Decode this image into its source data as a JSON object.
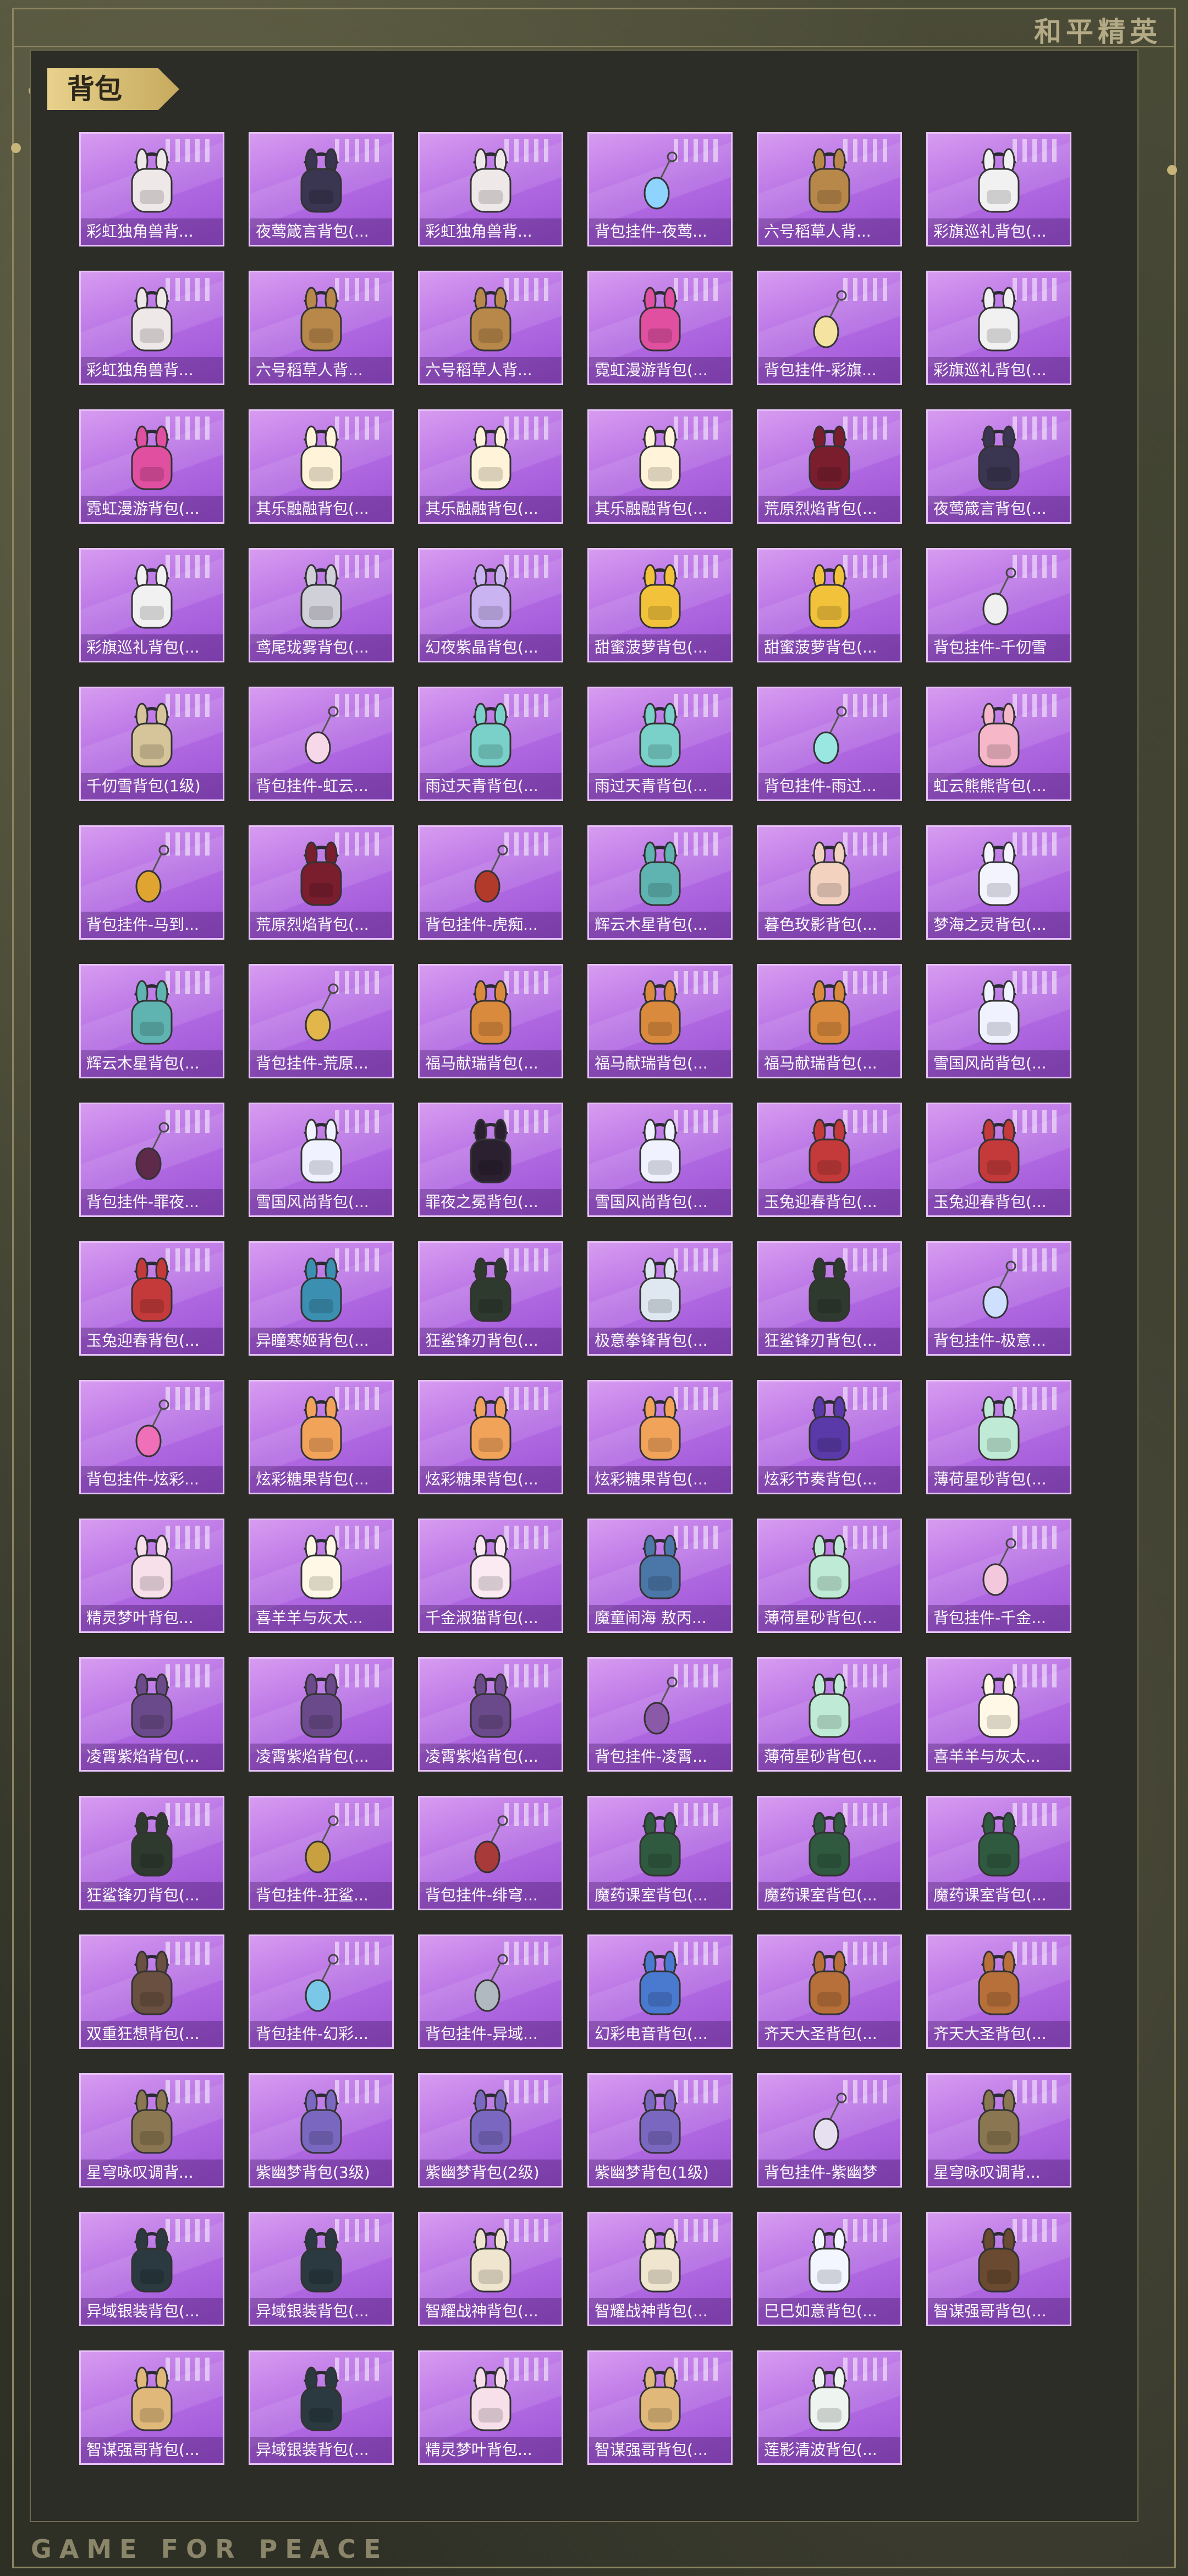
{
  "brand": "和平精英",
  "section_title": "背包",
  "footer": "GAME FOR PEACE",
  "items": [
    {
      "name": "彩虹独角兽背...",
      "icon": "bunny-backpack-icon",
      "color": "#efe8e8"
    },
    {
      "name": "夜莺箴言背包(...",
      "icon": "dark-pendant-backpack-icon",
      "color": "#3a3550"
    },
    {
      "name": "彩虹独角兽背...",
      "icon": "bunny-backpack-icon",
      "color": "#efe8e8"
    },
    {
      "name": "背包挂件-夜莺...",
      "icon": "pendant-charm-icon",
      "color": "#8fd3ff"
    },
    {
      "name": "六号稻草人背...",
      "icon": "scarecrow-backpack-icon",
      "color": "#b8874a"
    },
    {
      "name": "彩旗巡礼背包(...",
      "icon": "bunny-backpack-icon",
      "color": "#f1f1f1"
    },
    {
      "name": "彩虹独角兽背...",
      "icon": "bunny-backpack-icon",
      "color": "#efe8e8"
    },
    {
      "name": "六号稻草人背...",
      "icon": "scarecrow-backpack-icon",
      "color": "#b8874a"
    },
    {
      "name": "六号稻草人背...",
      "icon": "scarecrow-backpack-icon",
      "color": "#b8874a"
    },
    {
      "name": "霓虹漫游背包(...",
      "icon": "neon-backpack-icon",
      "color": "#e04fa0"
    },
    {
      "name": "背包挂件-彩旗...",
      "icon": "pendant-charm-icon",
      "color": "#f4e3a1"
    },
    {
      "name": "彩旗巡礼背包(...",
      "icon": "bunny-backpack-icon",
      "color": "#f1f1f1"
    },
    {
      "name": "霓虹漫游背包(...",
      "icon": "neon-backpack-icon",
      "color": "#e04fa0"
    },
    {
      "name": "其乐融融背包(...",
      "icon": "bunny-backpack-icon",
      "color": "#fff4d9"
    },
    {
      "name": "其乐融融背包(...",
      "icon": "bunny-backpack-icon",
      "color": "#fff4d9"
    },
    {
      "name": "其乐融融背包(...",
      "icon": "bunny-backpack-icon",
      "color": "#fff4d9"
    },
    {
      "name": "荒原烈焰背包(...",
      "icon": "dark-pendant-backpack-icon",
      "color": "#7a1e2e"
    },
    {
      "name": "夜莺箴言背包(...",
      "icon": "dark-pendant-backpack-icon",
      "color": "#3a3550"
    },
    {
      "name": "彩旗巡礼背包(...",
      "icon": "bunny-backpack-icon",
      "color": "#f1f1f1"
    },
    {
      "name": "鸢尾珑雾背包(...",
      "icon": "round-backpack-icon",
      "color": "#d0d0d8"
    },
    {
      "name": "幻夜紫晶背包(...",
      "icon": "round-backpack-icon",
      "color": "#c9b3f0"
    },
    {
      "name": "甜蜜菠萝背包(...",
      "icon": "pineapple-backpack-icon",
      "color": "#f2c23a"
    },
    {
      "name": "甜蜜菠萝背包(...",
      "icon": "pineapple-backpack-icon",
      "color": "#f2c23a"
    },
    {
      "name": "背包挂件-千仞雪",
      "icon": "feather-charm-icon",
      "color": "#f0f0f0"
    },
    {
      "name": "千仞雪背包(1级)",
      "icon": "round-backpack-icon",
      "color": "#d6c59a"
    },
    {
      "name": "背包挂件-虹云...",
      "icon": "pendant-charm-icon",
      "color": "#f7d8e8"
    },
    {
      "name": "雨过天青背包(...",
      "icon": "round-backpack-icon",
      "color": "#7ad1c9"
    },
    {
      "name": "雨过天青背包(...",
      "icon": "round-backpack-icon",
      "color": "#7ad1c9"
    },
    {
      "name": "背包挂件-雨过...",
      "icon": "pendant-charm-icon",
      "color": "#9ae6e1"
    },
    {
      "name": "虹云熊熊背包(...",
      "icon": "bear-backpack-icon",
      "color": "#f6b8c8"
    },
    {
      "name": "背包挂件-马到...",
      "icon": "horse-charm-icon",
      "color": "#e0a431"
    },
    {
      "name": "荒原烈焰背包(...",
      "icon": "dark-pendant-backpack-icon",
      "color": "#7a1e2e"
    },
    {
      "name": "背包挂件-虎痴...",
      "icon": "blade-charm-icon",
      "color": "#b23a2a"
    },
    {
      "name": "辉云木星背包(...",
      "icon": "round-backpack-icon",
      "color": "#5fb3b0"
    },
    {
      "name": "暮色玫影背包(...",
      "icon": "round-backpack-icon",
      "color": "#f3d2c0"
    },
    {
      "name": "梦海之灵背包(...",
      "icon": "bunny-backpack-icon",
      "color": "#f4f4ff"
    },
    {
      "name": "辉云木星背包(...",
      "icon": "round-backpack-icon",
      "color": "#5fb3b0"
    },
    {
      "name": "背包挂件-荒原...",
      "icon": "star-charm-icon",
      "color": "#e2b64a"
    },
    {
      "name": "福马献瑞背包(...",
      "icon": "horse-backpack-icon",
      "color": "#d98a3d"
    },
    {
      "name": "福马献瑞背包(...",
      "icon": "horse-backpack-icon",
      "color": "#d98a3d"
    },
    {
      "name": "福马献瑞背包(...",
      "icon": "horse-backpack-icon",
      "color": "#d98a3d"
    },
    {
      "name": "雪国风尚背包(...",
      "icon": "snowman-backpack-icon",
      "color": "#f0f3ff"
    },
    {
      "name": "背包挂件-罪夜...",
      "icon": "bat-charm-icon",
      "color": "#5d2a4a"
    },
    {
      "name": "雪国风尚背包(...",
      "icon": "snowman-backpack-icon",
      "color": "#f0f3ff"
    },
    {
      "name": "罪夜之冕背包(...",
      "icon": "dark-pendant-backpack-icon",
      "color": "#2a2030"
    },
    {
      "name": "雪国风尚背包(...",
      "icon": "snowman-backpack-icon",
      "color": "#f0f3ff"
    },
    {
      "name": "玉兔迎春背包(...",
      "icon": "rabbit-backpack-icon",
      "color": "#c43a3a"
    },
    {
      "name": "玉兔迎春背包(...",
      "icon": "rabbit-backpack-icon",
      "color": "#c43a3a"
    },
    {
      "name": "玉兔迎春背包(...",
      "icon": "rabbit-backpack-icon",
      "color": "#c43a3a"
    },
    {
      "name": "异瞳寒姬背包(...",
      "icon": "round-backpack-icon",
      "color": "#3b8fb0"
    },
    {
      "name": "狂鲨锋刃背包(...",
      "icon": "dark-pendant-backpack-icon",
      "color": "#2f3a2f"
    },
    {
      "name": "极意拳锋背包(...",
      "icon": "round-backpack-icon",
      "color": "#dfe8f0"
    },
    {
      "name": "狂鲨锋刃背包(...",
      "icon": "dark-pendant-backpack-icon",
      "color": "#2f3a2f"
    },
    {
      "name": "背包挂件-极意...",
      "icon": "pendant-charm-icon",
      "color": "#cfe0ff"
    },
    {
      "name": "背包挂件-炫彩...",
      "icon": "candy-charm-icon",
      "color": "#ef6fb8"
    },
    {
      "name": "炫彩糖果背包(...",
      "icon": "donut-backpack-icon",
      "color": "#f2a35a"
    },
    {
      "name": "炫彩糖果背包(...",
      "icon": "donut-backpack-icon",
      "color": "#f2a35a"
    },
    {
      "name": "炫彩糖果背包(...",
      "icon": "donut-backpack-icon",
      "color": "#f2a35a"
    },
    {
      "name": "炫彩节奏背包(...",
      "icon": "neon-backpack-icon",
      "color": "#5a3aa8"
    },
    {
      "name": "薄荷星砂背包(...",
      "icon": "round-backpack-icon",
      "color": "#bfead5"
    },
    {
      "name": "精灵梦叶背包...",
      "icon": "round-backpack-icon",
      "color": "#f7e0ea"
    },
    {
      "name": "喜羊羊与灰太...",
      "icon": "sheep-backpack-icon",
      "color": "#fff8e6"
    },
    {
      "name": "千金淑猫背包(...",
      "icon": "cat-backpack-icon",
      "color": "#fbeaf2"
    },
    {
      "name": "魔童闹海 敖丙...",
      "icon": "ring-backpack-icon",
      "color": "#4b77a8"
    },
    {
      "name": "薄荷星砂背包(...",
      "icon": "round-backpack-icon",
      "color": "#bfead5"
    },
    {
      "name": "背包挂件-千金...",
      "icon": "cat-charm-icon",
      "color": "#f3c8dc"
    },
    {
      "name": "凌霄紫焰背包(...",
      "icon": "round-backpack-icon",
      "color": "#6a4a8a"
    },
    {
      "name": "凌霄紫焰背包(...",
      "icon": "round-backpack-icon",
      "color": "#6a4a8a"
    },
    {
      "name": "凌霄紫焰背包(...",
      "icon": "round-backpack-icon",
      "color": "#6a4a8a"
    },
    {
      "name": "背包挂件-凌霄...",
      "icon": "pendant-charm-icon",
      "color": "#8a5aa8"
    },
    {
      "name": "薄荷星砂背包(...",
      "icon": "round-backpack-icon",
      "color": "#bfead5"
    },
    {
      "name": "喜羊羊与灰太...",
      "icon": "sheep-backpack-icon",
      "color": "#fff8e6"
    },
    {
      "name": "狂鲨锋刃背包(...",
      "icon": "dark-pendant-backpack-icon",
      "color": "#2f3a2f"
    },
    {
      "name": "背包挂件-狂鲨...",
      "icon": "blade-charm-icon",
      "color": "#c8a040"
    },
    {
      "name": "背包挂件-绯穹...",
      "icon": "blade-charm-icon",
      "color": "#a83a3a"
    },
    {
      "name": "魔药课室背包(...",
      "icon": "witch-backpack-icon",
      "color": "#2f5a40"
    },
    {
      "name": "魔药课室背包(...",
      "icon": "witch-backpack-icon",
      "color": "#2f5a40"
    },
    {
      "name": "魔药课室背包(...",
      "icon": "witch-backpack-icon",
      "color": "#2f5a40"
    },
    {
      "name": "双重狂想背包(...",
      "icon": "horse-backpack-icon",
      "color": "#6a5040"
    },
    {
      "name": "背包挂件-幻彩...",
      "icon": "cube-charm-icon",
      "color": "#7ac8e8"
    },
    {
      "name": "背包挂件-异域...",
      "icon": "blade-charm-icon",
      "color": "#b0b8c0"
    },
    {
      "name": "幻彩电音背包(...",
      "icon": "ring-backpack-icon",
      "color": "#4a7ad0"
    },
    {
      "name": "齐天大圣背包(...",
      "icon": "monkey-backpack-icon",
      "color": "#b8703a"
    },
    {
      "name": "齐天大圣背包(...",
      "icon": "monkey-backpack-icon",
      "color": "#b8703a"
    },
    {
      "name": "星穹咏叹调背...",
      "icon": "bunny-backpack-icon",
      "color": "#8a7650"
    },
    {
      "name": "紫幽梦背包(3级)",
      "icon": "round-backpack-icon",
      "color": "#7a68c0"
    },
    {
      "name": "紫幽梦背包(2级)",
      "icon": "round-backpack-icon",
      "color": "#7a68c0"
    },
    {
      "name": "紫幽梦背包(1级)",
      "icon": "round-backpack-icon",
      "color": "#7a68c0"
    },
    {
      "name": "背包挂件-紫幽梦",
      "icon": "pendant-charm-icon",
      "color": "#e6e0f0"
    },
    {
      "name": "星穹咏叹调背...",
      "icon": "bunny-backpack-icon",
      "color": "#8a7650"
    },
    {
      "name": "异域银装背包(...",
      "icon": "tech-backpack-icon",
      "color": "#2a3a40"
    },
    {
      "name": "异域银装背包(...",
      "icon": "tech-backpack-icon",
      "color": "#2a3a40"
    },
    {
      "name": "智耀战神背包(...",
      "icon": "round-backpack-icon",
      "color": "#f0e6d0"
    },
    {
      "name": "智耀战神背包(...",
      "icon": "round-backpack-icon",
      "color": "#f0e6d0"
    },
    {
      "name": "巳巳如意背包(...",
      "icon": "round-backpack-icon",
      "color": "#f3f6ff"
    },
    {
      "name": "智谋强哥背包(...",
      "icon": "bear-backpack-icon",
      "color": "#6a4a30"
    },
    {
      "name": "智谋强哥背包(...",
      "icon": "bear-backpack-icon",
      "color": "#e0b87a"
    },
    {
      "name": "异域银装背包(...",
      "icon": "tech-backpack-icon",
      "color": "#2a3a40"
    },
    {
      "name": "精灵梦叶背包...",
      "icon": "round-backpack-icon",
      "color": "#f7e0ea"
    },
    {
      "name": "智谋强哥背包(...",
      "icon": "bear-backpack-icon",
      "color": "#e0b87a"
    },
    {
      "name": "莲影清波背包(...",
      "icon": "round-backpack-icon",
      "color": "#eef4f0"
    }
  ]
}
